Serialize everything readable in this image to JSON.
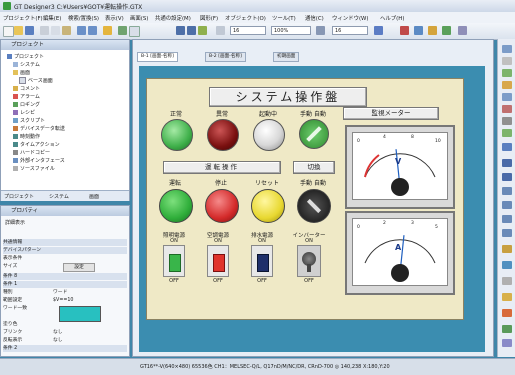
{
  "window": {
    "title": "GT Designer3 C:¥Users¥GOT¥運転操作.GTX"
  },
  "menu": [
    "プロジェクト(F)",
    "編集(E)",
    "検索/置換(S)",
    "表示(V)",
    "画面(S)",
    "共通の設定(M)",
    "図形(F)",
    "オブジェクト(O)",
    "ツール(T)",
    "通信(C)",
    "ウィンドウ(W)",
    "ヘルプ(H)"
  ],
  "toolbar": {
    "font_size": "16",
    "zoom": "100%",
    "grid": "16"
  },
  "project_panel": {
    "title": "プロジェクト",
    "tree": [
      "プロジェクト",
      "システム",
      "画面",
      "ベース画面",
      "コメント",
      "アラーム",
      "ロギング",
      "レシピ",
      "スクリプト",
      "デバイスデータ転送",
      "時刻動作",
      "タイムアクション",
      "ハードコピー",
      "外部インタフェース",
      "ソースファイル"
    ],
    "tabs": [
      "プロジェクト",
      "システム",
      "画面"
    ]
  },
  "properties_panel": {
    "title": "プロパティ",
    "subtitle": "詳細表示",
    "rows": [
      {
        "name": "共通情報",
        "value": ""
      },
      {
        "name": "デバイスパターン",
        "value": ""
      },
      {
        "name": "表示条件",
        "value": ""
      },
      {
        "name": "サイズ",
        "value": "設定"
      },
      {
        "name": "条件 8",
        "value": ""
      },
      {
        "name": "条件 1",
        "value": ""
      },
      {
        "name": "種別",
        "value": "ワード"
      },
      {
        "name": "範囲設定",
        "value": "$V==10"
      },
      {
        "name": "ワード一致",
        "value": ""
      },
      {
        "name": "塗り色",
        "value": ""
      },
      {
        "name": "ブリンク",
        "value": "なし"
      },
      {
        "name": "反転表示",
        "value": "なし"
      },
      {
        "name": "条件 2",
        "value": ""
      }
    ]
  },
  "editor": {
    "tabs": [
      "B-1 [画面-名称]",
      "B-2 [画面-名称]",
      "初期画面"
    ],
    "panel_title": "システム操作盤",
    "status_lamps": [
      {
        "label": "正常",
        "color": "#3fb04a"
      },
      {
        "label": "異常",
        "color": "#7a1010"
      },
      {
        "label": "起動中",
        "color": "#d8d8d8"
      },
      {
        "label": "手動 自動",
        "color": "#4fb84f"
      }
    ],
    "meter_section_label": "監視メーター",
    "operation_section_label": "運転操作",
    "switch_section_label": "切換",
    "operation_buttons": [
      {
        "label": "運転",
        "color": "#2fae3a"
      },
      {
        "label": "停止",
        "color": "#d42a2a"
      },
      {
        "label": "リセット",
        "color": "#e8d830"
      },
      {
        "label": "手動 自動",
        "color": "#222222"
      }
    ],
    "toggles": [
      {
        "label": "照明電源",
        "on": "ON",
        "off": "OFF",
        "color": "#39b54a"
      },
      {
        "label": "空調電源",
        "on": "ON",
        "off": "OFF",
        "color": "#e0332c"
      },
      {
        "label": "排水電源",
        "on": "ON",
        "off": "OFF",
        "color": "#1f2f6a"
      },
      {
        "label": "インバーター",
        "on": "ON",
        "off": "OFF",
        "color": "#555555"
      }
    ],
    "meters": [
      {
        "unit": "V",
        "scale": [
          "0",
          "2",
          "4",
          "6",
          "8",
          "10"
        ],
        "value_fraction": 0.45
      },
      {
        "unit": "A",
        "scale": [
          "0",
          "1",
          "2",
          "3",
          "4",
          "5"
        ],
        "value_fraction": 0.55
      }
    ]
  },
  "statusbar": {
    "text": "GT16**-V(640×480) 65536色 CH1：MELSEC-Q/L, Q17nD/M/NC/DR, CRnD-700 ◎ 140,238 X:180,Y:20"
  }
}
